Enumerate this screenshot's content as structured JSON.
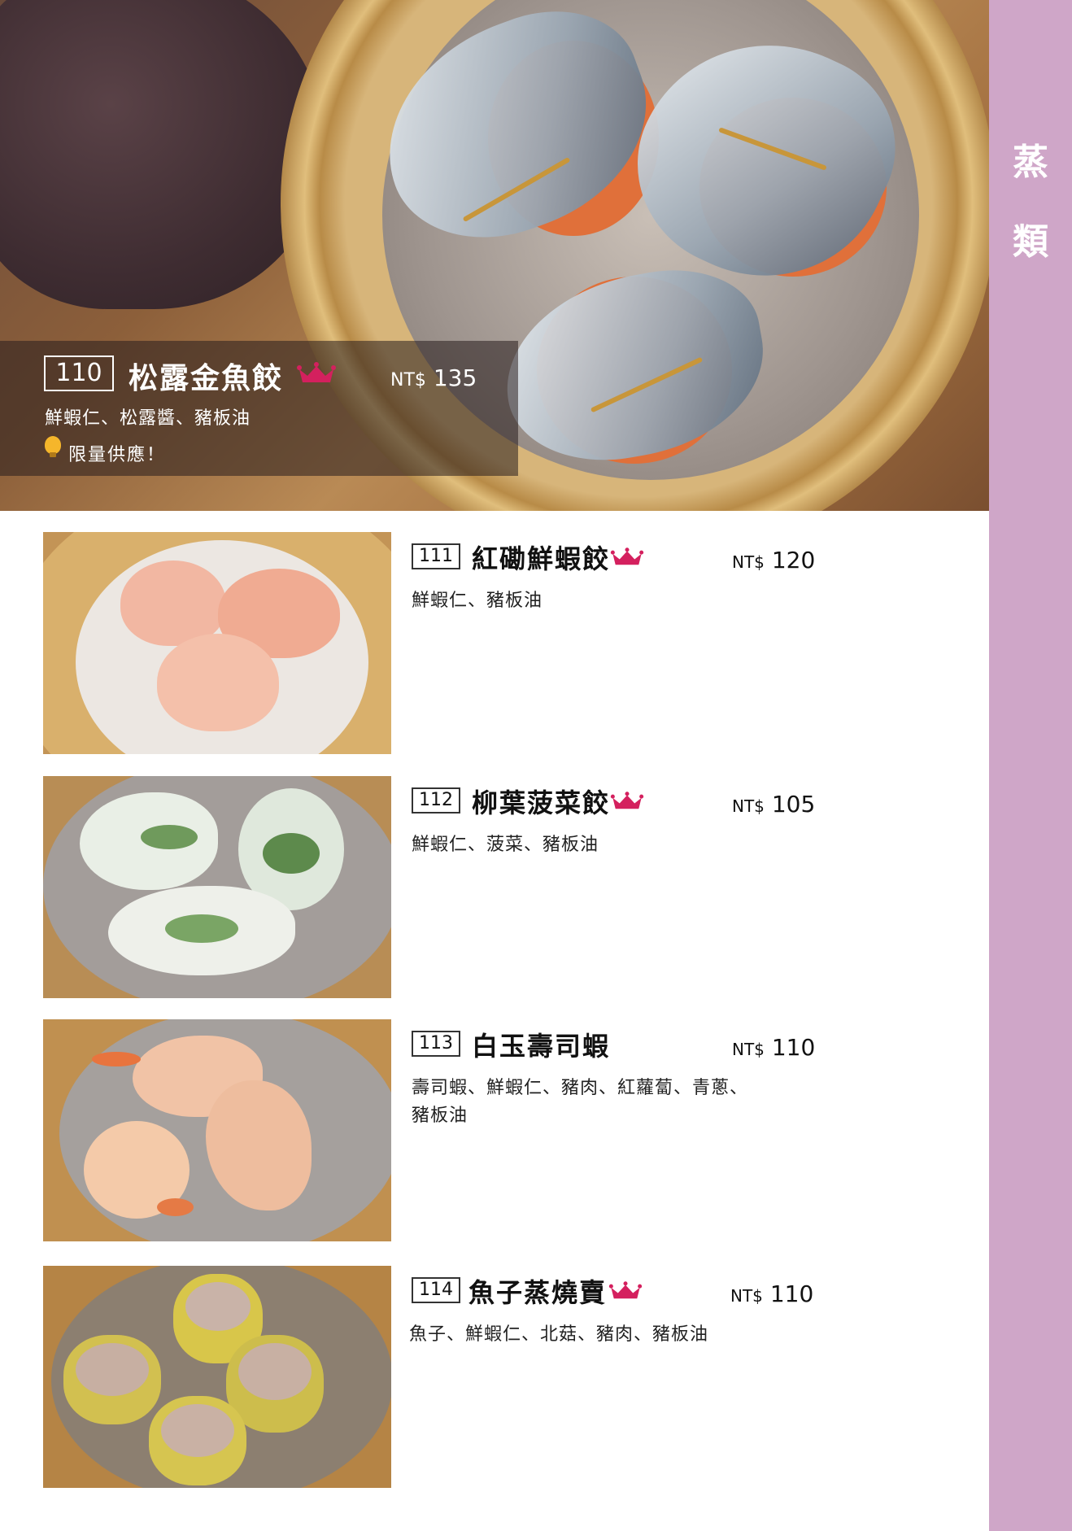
{
  "sidebar": {
    "category_chars": [
      "蒸",
      "類"
    ],
    "color": "#cfa6c8"
  },
  "currency": "NT$",
  "featured": {
    "number": "110",
    "name": "松露金魚餃",
    "price": "135",
    "description": "鮮蝦仁、松露醬、豬板油",
    "note": "限量供應！",
    "crown": true
  },
  "items": [
    {
      "number": "111",
      "name": "紅磡鮮蝦餃",
      "price": "120",
      "description": "鮮蝦仁、豬板油",
      "crown": true
    },
    {
      "number": "112",
      "name": "柳葉菠菜餃",
      "price": "105",
      "description": "鮮蝦仁、菠菜、豬板油",
      "crown": true
    },
    {
      "number": "113",
      "name": "白玉壽司蝦",
      "price": "110",
      "description": "壽司蝦、鮮蝦仁、豬肉、紅蘿蔔、青蔥、豬板油",
      "crown": false
    },
    {
      "number": "114",
      "name": "魚子蒸燒賣",
      "price": "110",
      "description": "魚子、鮮蝦仁、北菇、豬肉、豬板油",
      "crown": true
    }
  ],
  "colors": {
    "crown": "#d4205e",
    "accent": "#cfa6c8"
  },
  "icons": {
    "crown": "crown-icon",
    "bulb": "lightbulb-icon"
  }
}
